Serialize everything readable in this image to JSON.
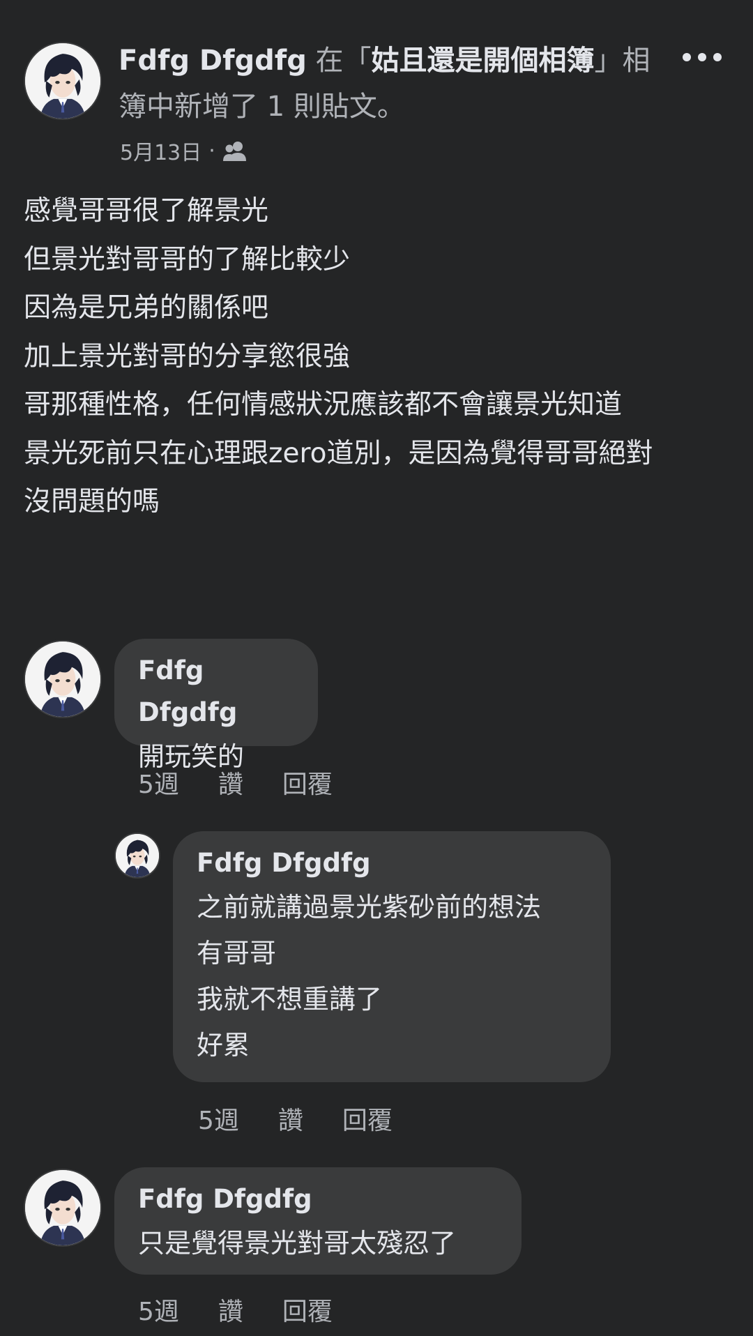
{
  "post": {
    "author": "Fdfg Dfgdfg",
    "action_prefix": " 在「",
    "album_name": "姑且還是開個相簿",
    "action_suffix": "」相簿中新增了 1 則貼文。",
    "date": "5月13日",
    "separator": "·",
    "privacy_icon": "friends-icon",
    "more_icon": "more-options-icon",
    "lines": [
      "感覺哥哥很了解景光",
      "但景光對哥哥的了解比較少",
      "因為是兄弟的關係吧",
      "加上景光對哥的分享慾很強",
      "哥那種性格，任何情感狀況應該都不會讓景光知道",
      "景光死前只在心理跟zero道別，是因為覺得哥哥絕對",
      "沒問題的嗎"
    ]
  },
  "comments": [
    {
      "author": "Fdfg Dfgdfg",
      "lines": [
        "開玩笑的"
      ],
      "time": "5週",
      "like": "讚",
      "reply": "回覆"
    },
    {
      "author": "Fdfg Dfgdfg",
      "lines": [
        "之前就講過景光紫砂前的想法",
        "有哥哥",
        "我就不想重講了",
        "好累"
      ],
      "time": "5週",
      "like": "讚",
      "reply": "回覆"
    },
    {
      "author": "Fdfg Dfgdfg",
      "lines": [
        "只是覺得景光對哥太殘忍了"
      ],
      "time": "5週",
      "like": "讚",
      "reply": "回覆"
    }
  ],
  "colors": {
    "background": "#242526",
    "bubble": "#3a3b3c",
    "primary_text": "#e4e6eb",
    "secondary_text": "#b0b3b8"
  }
}
